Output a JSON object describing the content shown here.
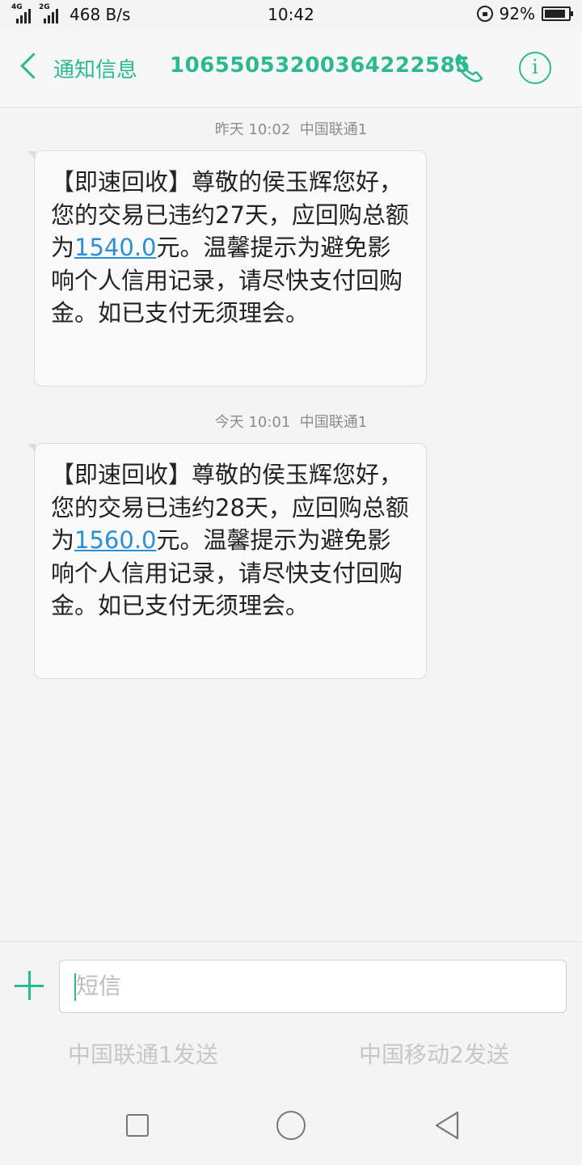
{
  "status_bar": {
    "sim1_tag": "4G",
    "sim2_tag": "2G",
    "network_speed": "468 B/s",
    "time": "10:42",
    "battery": "92%",
    "battery_level": 0.92
  },
  "header": {
    "back_label": "通知信息",
    "sender_number": "10655053200364222585",
    "accent_color": "#2bba8f",
    "icons": [
      "back-chevron-icon",
      "phone-icon",
      "info-icon"
    ]
  },
  "messages": [
    {
      "timestamp": "昨天 10:02",
      "carrier": "中国联通1",
      "text_before": "【即速回收】尊敬的侯玉辉您好，您的交易已违约27天，应回购总额为",
      "amount": "1540.0",
      "text_after": "元。温馨提示为避免影响个人信用记录，请尽快支付回购金。如已支付无须理会。"
    },
    {
      "timestamp": "今天 10:01",
      "carrier": "中国联通1",
      "text_before": "【即速回收】尊敬的侯玉辉您好，您的交易已违约28天，应回购总额为",
      "amount": "1560.0",
      "text_after": "元。温馨提示为避免影响个人信用记录，请尽快支付回购金。如已支付无须理会。"
    }
  ],
  "composer": {
    "placeholder": "短信",
    "send_sim1": "中国联通1发送",
    "send_sim2": "中国移动2发送"
  },
  "nav": {
    "icons": [
      "recent-apps-icon",
      "home-icon",
      "back-icon"
    ]
  }
}
